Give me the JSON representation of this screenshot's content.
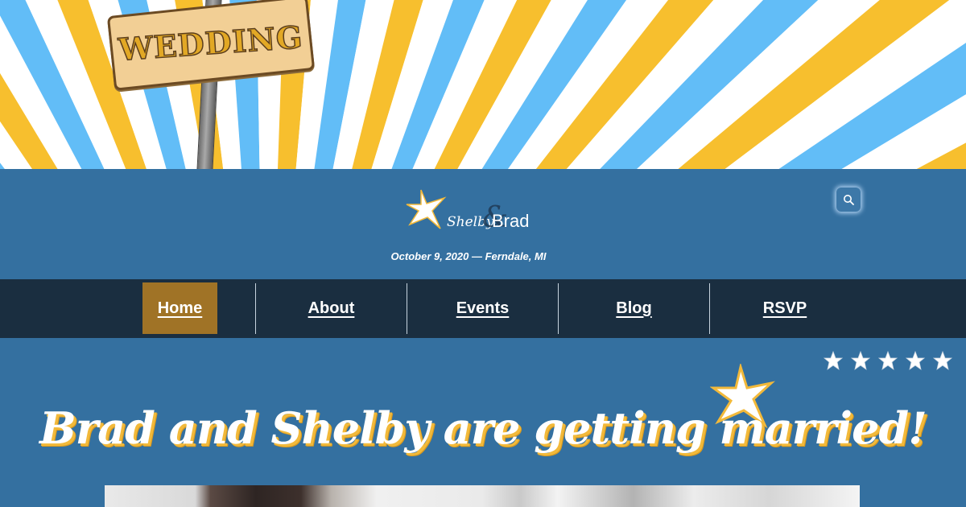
{
  "banner": {
    "sign_text": "WEDDING",
    "colors": {
      "blue_stripe": "#62bdf7",
      "gold_stripe": "#f7bf2e",
      "background": "#ffffff"
    }
  },
  "header": {
    "logo": {
      "name1": "Shelby",
      "amp": "&",
      "name2": "Brad"
    },
    "tagline": "October 9, 2020 — Ferndale, MI",
    "search_icon": "search-icon"
  },
  "nav": {
    "items": [
      {
        "label": "Home",
        "active": true
      },
      {
        "label": "About",
        "active": false
      },
      {
        "label": "Events",
        "active": false
      },
      {
        "label": "Blog",
        "active": false
      },
      {
        "label": "RSVP",
        "active": false
      }
    ]
  },
  "main": {
    "headline": "Brad and Shelby are getting married!",
    "rating_stars": 5,
    "decor_icon": "star-icon"
  },
  "colors": {
    "header_bg": "#3470a0",
    "nav_bg": "#1a2e40",
    "nav_active": "#a07326",
    "accent_gold": "#f2b93a"
  }
}
